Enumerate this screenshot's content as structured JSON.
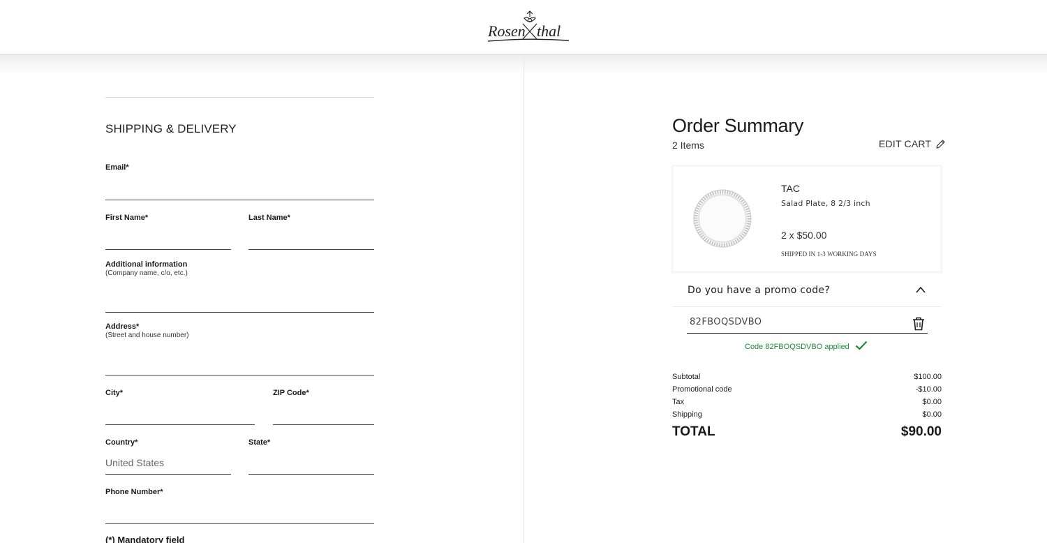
{
  "header": {
    "logo_alt": "Rosenthal"
  },
  "shipping": {
    "title": "SHIPPING & DELIVERY",
    "email_label": "Email*",
    "first_name_label": "First Name*",
    "last_name_label": "Last Name*",
    "additional_label": "Additional information",
    "additional_sub": "(Company name, c/o, etc.)",
    "address_label": "Address*",
    "address_sub": "(Street and house number)",
    "city_label": "City*",
    "zip_label": "ZIP Code*",
    "country_label": "Country*",
    "country_value": "United States",
    "state_label": "State*",
    "phone_label": "Phone Number*",
    "mandatory_note": "(*) Mandatory field"
  },
  "summary": {
    "title": "Order Summary",
    "items_count": "2 Items",
    "edit_cart": "EDIT CART",
    "product": {
      "brand": "TAC",
      "name": "Salad Plate, 8 2/3 inch",
      "price": "2 x $50.00",
      "shipping_note": "SHIPPED IN 1-3 WORKING DAYS"
    },
    "promo": {
      "question": "Do you have a promo code?",
      "code": "82FBOQSDVBO",
      "applied": "Code 82FBOQSDVBO applied"
    },
    "totals": {
      "subtotal_label": "Subtotal",
      "subtotal": "$100.00",
      "promo_label": "Promotional code",
      "promo": "-$10.00",
      "tax_label": "Tax",
      "tax": "$0.00",
      "shipping_label": "Shipping",
      "shipping": "$0.00",
      "total_label": "TOTAL",
      "total": "$90.00"
    }
  },
  "colors": {
    "success": "#1c8a3a",
    "text": "#1a1a1a",
    "divider": "#e4e4e4"
  }
}
